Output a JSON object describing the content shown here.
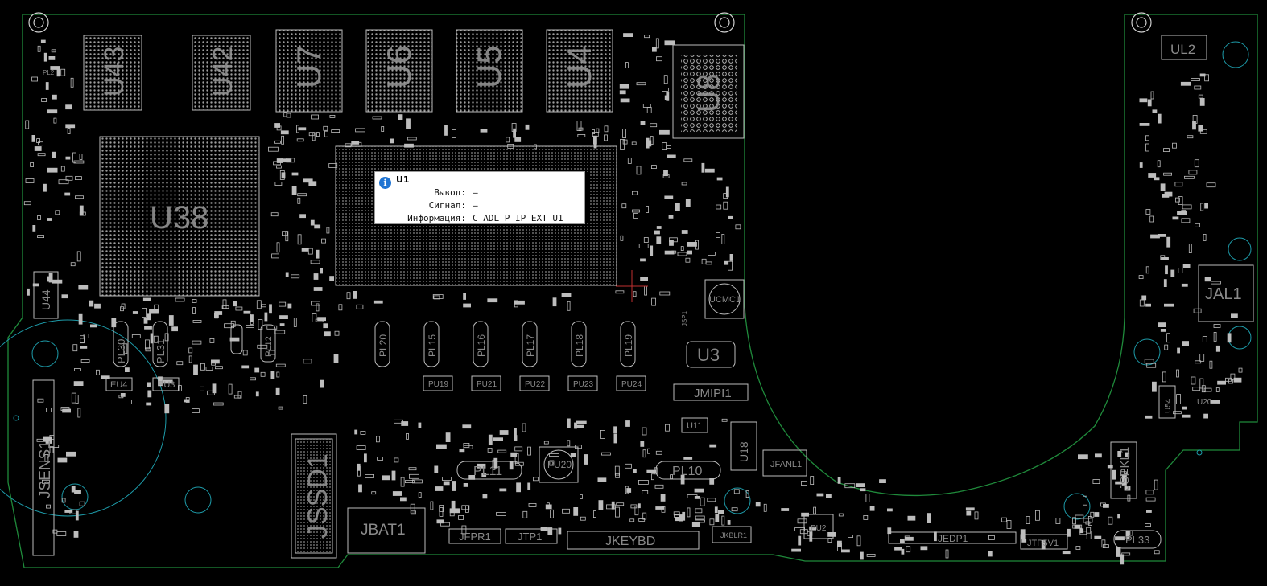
{
  "tooltip": {
    "title": "U1",
    "icon": "info-icon",
    "rows": [
      {
        "key": "Вывод:",
        "value": "—"
      },
      {
        "key": "Сигнал:",
        "value": "—"
      },
      {
        "key": "Информация:",
        "value": "C_ADL_P_IP_EXT U1"
      }
    ]
  },
  "big_labels": {
    "u43": "U43",
    "u42": "U42",
    "u7": "U7",
    "u6": "U6",
    "u5": "U5",
    "u4": "U4",
    "u8": "U8",
    "u38": "U38",
    "u3": "U3",
    "ul2": "UL2",
    "jal1": "JAL1",
    "jssd1": "JSSD1",
    "jbat1": "JBAT1",
    "jkeybd": "JKEYBD",
    "jedp1": "JEDP1",
    "jmipi1": "JMIPI1",
    "jsens1": "JSENS1",
    "jspkl1": "JSPKL1",
    "jfpr1": "JFPR1",
    "jtp1": "JTP1",
    "jtp5v1": "JTP5V1",
    "pl11": "PL11",
    "pl10": "PL10",
    "pl33": "PL33",
    "u44": "U44",
    "u18": "U18",
    "jfanl1": "JFANL1",
    "ucmc1": "UCMC1",
    "u11": "U11",
    "u54": "U54",
    "u20": "U20",
    "pu20": "PU20",
    "jkblr1": "JKBLR1",
    "eu4": "EU4",
    "eu3": "EU3",
    "pl30": "PL30",
    "pl31": "PL31",
    "pl12": "PL12",
    "pl20": "PL20",
    "pl15": "PL15",
    "pl16": "PL16",
    "pl17": "PL17",
    "pl18": "PL18",
    "pl19": "PL19",
    "pu19": "PU19",
    "pu21": "PU21",
    "pu22": "PU22",
    "pu23": "PU23",
    "pu24": "PU24",
    "pl2": "PL2",
    "pu2": "PU2",
    "jsp1": "JSP1"
  },
  "colors": {
    "background": "#000000",
    "board_outline": "#1f8a3b",
    "highlight_circle": "#1d9aa8",
    "component": "#bdbdbd",
    "label": "#8a8a8a",
    "tooltip_bg": "#ffffff",
    "info_icon": "#1e73d2"
  }
}
